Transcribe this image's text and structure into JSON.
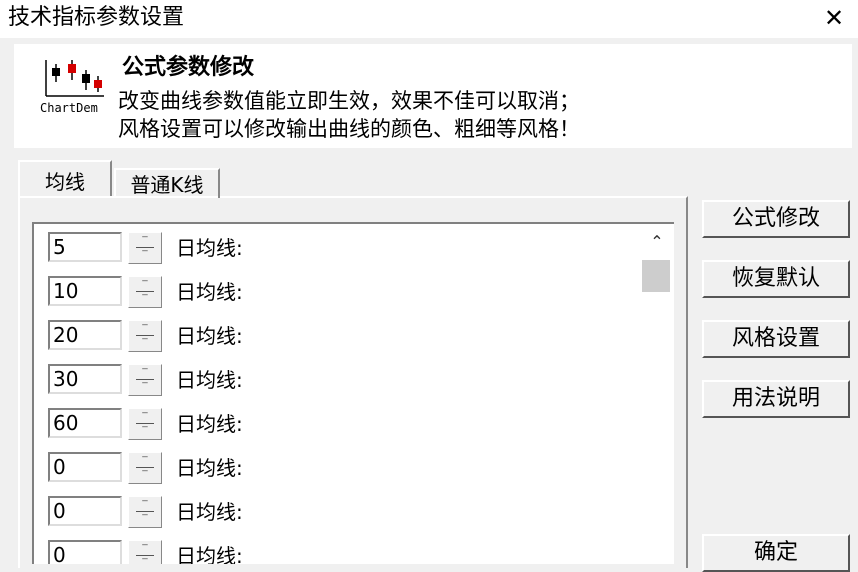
{
  "window": {
    "title": "技术指标参数设置",
    "close": "✕"
  },
  "header": {
    "logo_text": "ChartDem",
    "title": "公式参数修改",
    "line1": "改变曲线参数值能立即生效，效果不佳可以取消；",
    "line2": "风格设置可以修改输出曲线的颜色、粗细等风格！"
  },
  "tabs": [
    {
      "label": "均线",
      "active": true
    },
    {
      "label": "普通K线",
      "active": false
    }
  ],
  "params": [
    {
      "value": "5",
      "label": "日均线:"
    },
    {
      "value": "10",
      "label": "日均线:"
    },
    {
      "value": "20",
      "label": "日均线:"
    },
    {
      "value": "30",
      "label": "日均线:"
    },
    {
      "value": "60",
      "label": "日均线:"
    },
    {
      "value": "0",
      "label": "日均线:"
    },
    {
      "value": "0",
      "label": "日均线:"
    },
    {
      "value": "0",
      "label": "日均线:"
    }
  ],
  "buttons": {
    "formula_edit": "公式修改",
    "restore_default": "恢复默认",
    "style_settings": "风格设置",
    "usage_help": "用法说明",
    "ok": "确定"
  },
  "colors": {
    "window_bg": "#f0f0f0",
    "logo_red": "#d40000"
  }
}
